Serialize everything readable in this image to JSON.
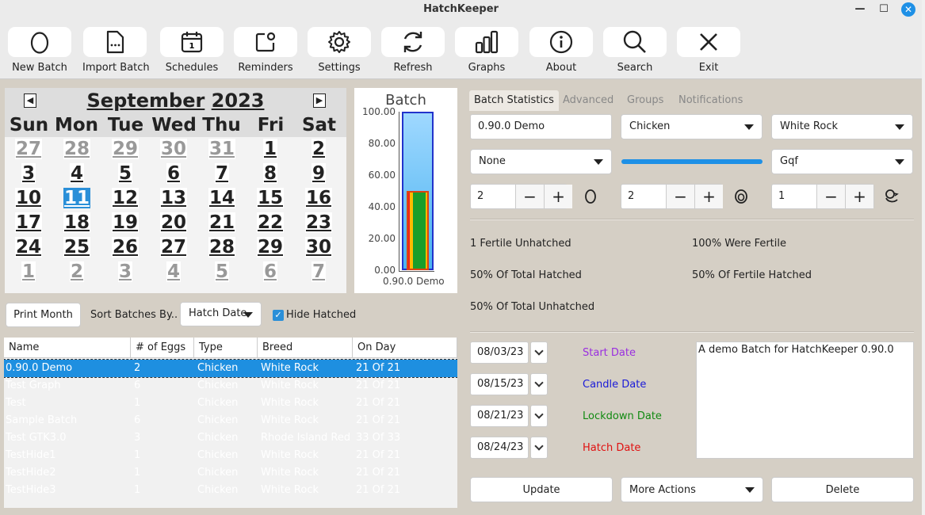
{
  "window": {
    "title": "HatchKeeper",
    "min_icon": "minimize-icon",
    "max_icon": "maximize-icon",
    "close_icon": "close-icon"
  },
  "toolbar": [
    {
      "label": "New Batch",
      "icon": "egg-icon"
    },
    {
      "label": "Import Batch",
      "icon": "document-icon"
    },
    {
      "label": "Schedules",
      "icon": "calendar-icon"
    },
    {
      "label": "Reminders",
      "icon": "notification-icon"
    },
    {
      "label": "Settings",
      "icon": "gear-icon"
    },
    {
      "label": "Refresh",
      "icon": "refresh-icon"
    },
    {
      "label": "Graphs",
      "icon": "bar-chart-icon"
    },
    {
      "label": "About",
      "icon": "info-icon"
    },
    {
      "label": "Search",
      "icon": "search-icon"
    },
    {
      "label": "Exit",
      "icon": "close-icon"
    }
  ],
  "calendar": {
    "month": "September",
    "year": "2023",
    "days_of_week": [
      "Sun",
      "Mon",
      "Tue",
      "Wed",
      "Thu",
      "Fri",
      "Sat"
    ],
    "weeks": [
      [
        "27",
        "28",
        "29",
        "30",
        "31",
        "1",
        "2"
      ],
      [
        "3",
        "4",
        "5",
        "6",
        "7",
        "8",
        "9"
      ],
      [
        "10",
        "11",
        "12",
        "13",
        "14",
        "15",
        "16"
      ],
      [
        "17",
        "18",
        "19",
        "20",
        "21",
        "22",
        "23"
      ],
      [
        "24",
        "25",
        "26",
        "27",
        "28",
        "29",
        "30"
      ],
      [
        "1",
        "2",
        "3",
        "4",
        "5",
        "6",
        "7"
      ]
    ],
    "selected_day": "11"
  },
  "batch_graph": {
    "title": "Batch",
    "ticks": [
      "100.00",
      "80.00",
      "60.00",
      "40.00",
      "20.00",
      "0.00"
    ],
    "x_label": "0.90.0 Demo",
    "total_pct": 100,
    "hatched_pct": 50
  },
  "controls": {
    "print_month": "Print Month",
    "sort_label": "Sort Batches By..",
    "sort_value": "Hatch Date",
    "hide_hatched": "Hide Hatched",
    "hide_hatched_checked": true
  },
  "table": {
    "columns": [
      "Name",
      "# of Eggs",
      "Type",
      "Breed",
      "On Day"
    ],
    "rows": [
      [
        "0.90.0 Demo",
        "2",
        "Chicken",
        "White Rock",
        "21 Of 21"
      ],
      [
        "Test Graph",
        "6",
        "Chicken",
        "White Rock",
        "21 Of 21"
      ],
      [
        "Test",
        "1",
        "Chicken",
        "White Rock",
        "21 Of 21"
      ],
      [
        "Sample Batch",
        "6",
        "Chicken",
        "White Rock",
        "21 Of 21"
      ],
      [
        "Test GTK3.0",
        "3",
        "Chicken",
        "Rhode Island Red",
        "33 Of 33"
      ],
      [
        "TestHide1",
        "1",
        "Chicken",
        "White Rock",
        "21 Of 21"
      ],
      [
        "TestHide2",
        "1",
        "Chicken",
        "White Rock",
        "21 Of 21"
      ],
      [
        "TestHide3",
        "1",
        "Chicken",
        "White Rock",
        "21 Of 21"
      ]
    ]
  },
  "detail": {
    "tabs": [
      "Batch Statistics",
      "Advanced",
      "Groups",
      "Notifications"
    ],
    "name": "0.90.0 Demo",
    "type": "Chicken",
    "breed": "White Rock",
    "group": "None",
    "color": "#1e90e6",
    "extra": "Gqf",
    "eggs": "2",
    "fertile": "2",
    "hatched": "1",
    "stats": {
      "fertile_unhatched": "1 Fertile Unhatched",
      "were_fertile": "100% Were Fertile",
      "total_hatched": "50% Of Total Hatched",
      "fertile_hatched": "50% Of Fertile Hatched",
      "total_unhatched": "50% Of Total Unhatched"
    },
    "dates": [
      {
        "value": "08/03/23",
        "label": "Start Date",
        "color": "#9a2ee0"
      },
      {
        "value": "08/15/23",
        "label": "Candle Date",
        "color": "#1a1ad8"
      },
      {
        "value": "08/21/23",
        "label": "Lockdown Date",
        "color": "#118a11"
      },
      {
        "value": "08/24/23",
        "label": "Hatch Date",
        "color": "#e01010"
      }
    ],
    "notes": "A demo Batch for HatchKeeper 0.90.0",
    "update": "Update",
    "more_actions": "More Actions",
    "delete": "Delete"
  }
}
